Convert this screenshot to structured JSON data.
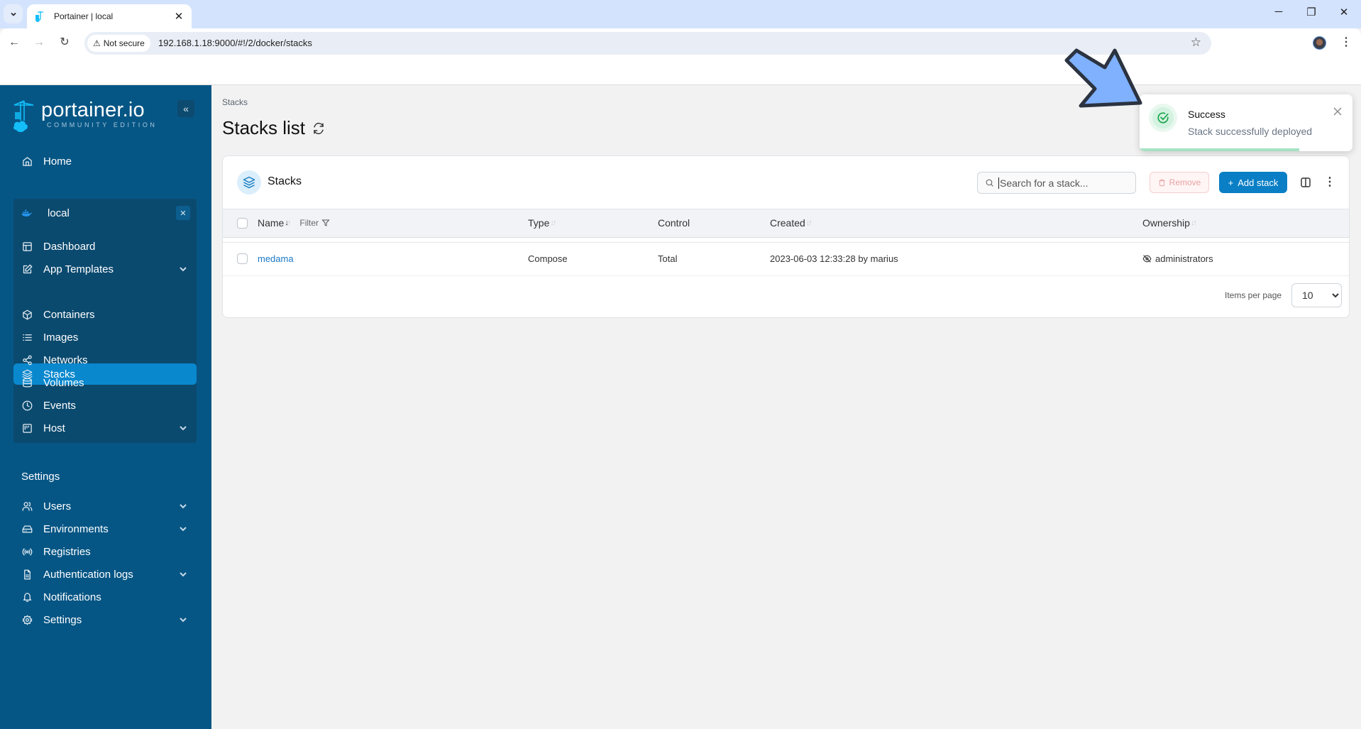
{
  "browser": {
    "tab_title": "Portainer | local",
    "not_secure_label": "Not secure",
    "url": "192.168.1.18:9000/#!/2/docker/stacks"
  },
  "sidebar": {
    "logo_text": "portainer.io",
    "logo_subtitle": "COMMUNITY EDITION",
    "collapse_label": "«",
    "home_label": "Home",
    "environment": {
      "name": "local",
      "close_label": "✕",
      "items": [
        {
          "label": "Dashboard",
          "icon": "dashboard-icon",
          "expandable": false,
          "active": false
        },
        {
          "label": "App Templates",
          "icon": "edit-icon",
          "expandable": true,
          "active": false
        },
        {
          "label": "Stacks",
          "icon": "layers-icon",
          "expandable": false,
          "active": true
        },
        {
          "label": "Containers",
          "icon": "box-icon",
          "expandable": false,
          "active": false
        },
        {
          "label": "Images",
          "icon": "list-icon",
          "expandable": false,
          "active": false
        },
        {
          "label": "Networks",
          "icon": "share-icon",
          "expandable": false,
          "active": false
        },
        {
          "label": "Volumes",
          "icon": "database-icon",
          "expandable": false,
          "active": false
        },
        {
          "label": "Events",
          "icon": "clock-icon",
          "expandable": false,
          "active": false
        },
        {
          "label": "Host",
          "icon": "host-icon",
          "expandable": true,
          "active": false
        }
      ]
    },
    "settings_title": "Settings",
    "settings_items": [
      {
        "label": "Users",
        "icon": "users-icon",
        "expandable": true
      },
      {
        "label": "Environments",
        "icon": "hard-drive-icon",
        "expandable": true
      },
      {
        "label": "Registries",
        "icon": "radio-icon",
        "expandable": false
      },
      {
        "label": "Authentication logs",
        "icon": "file-text-icon",
        "expandable": true
      },
      {
        "label": "Notifications",
        "icon": "bell-icon",
        "expandable": false
      },
      {
        "label": "Settings",
        "icon": "gear-icon",
        "expandable": true
      }
    ]
  },
  "main": {
    "breadcrumb": "Stacks",
    "page_title": "Stacks list",
    "card": {
      "title": "Stacks",
      "search_placeholder": "Search for a stack...",
      "search_value": "",
      "remove_label": "Remove",
      "add_label": "Add stack",
      "columns": {
        "name": "Name",
        "filter": "Filter",
        "type": "Type",
        "control": "Control",
        "created": "Created",
        "ownership": "Ownership"
      },
      "rows": [
        {
          "name": "medama",
          "type": "Compose",
          "control": "Total",
          "created": "2023-06-03 12:33:28 by marius",
          "ownership": "administrators"
        }
      ],
      "items_per_page_label": "Items per page",
      "items_per_page_value": "10"
    }
  },
  "toast": {
    "title": "Success",
    "message": "Stack successfully deployed",
    "progress_percent": 75
  },
  "colors": {
    "sidebar_bg": "#065685",
    "active_item": "#0988ce",
    "primary_button": "#0a7fc6",
    "success": "#16a34a",
    "annotation_arrow": "#7fb1ff"
  }
}
